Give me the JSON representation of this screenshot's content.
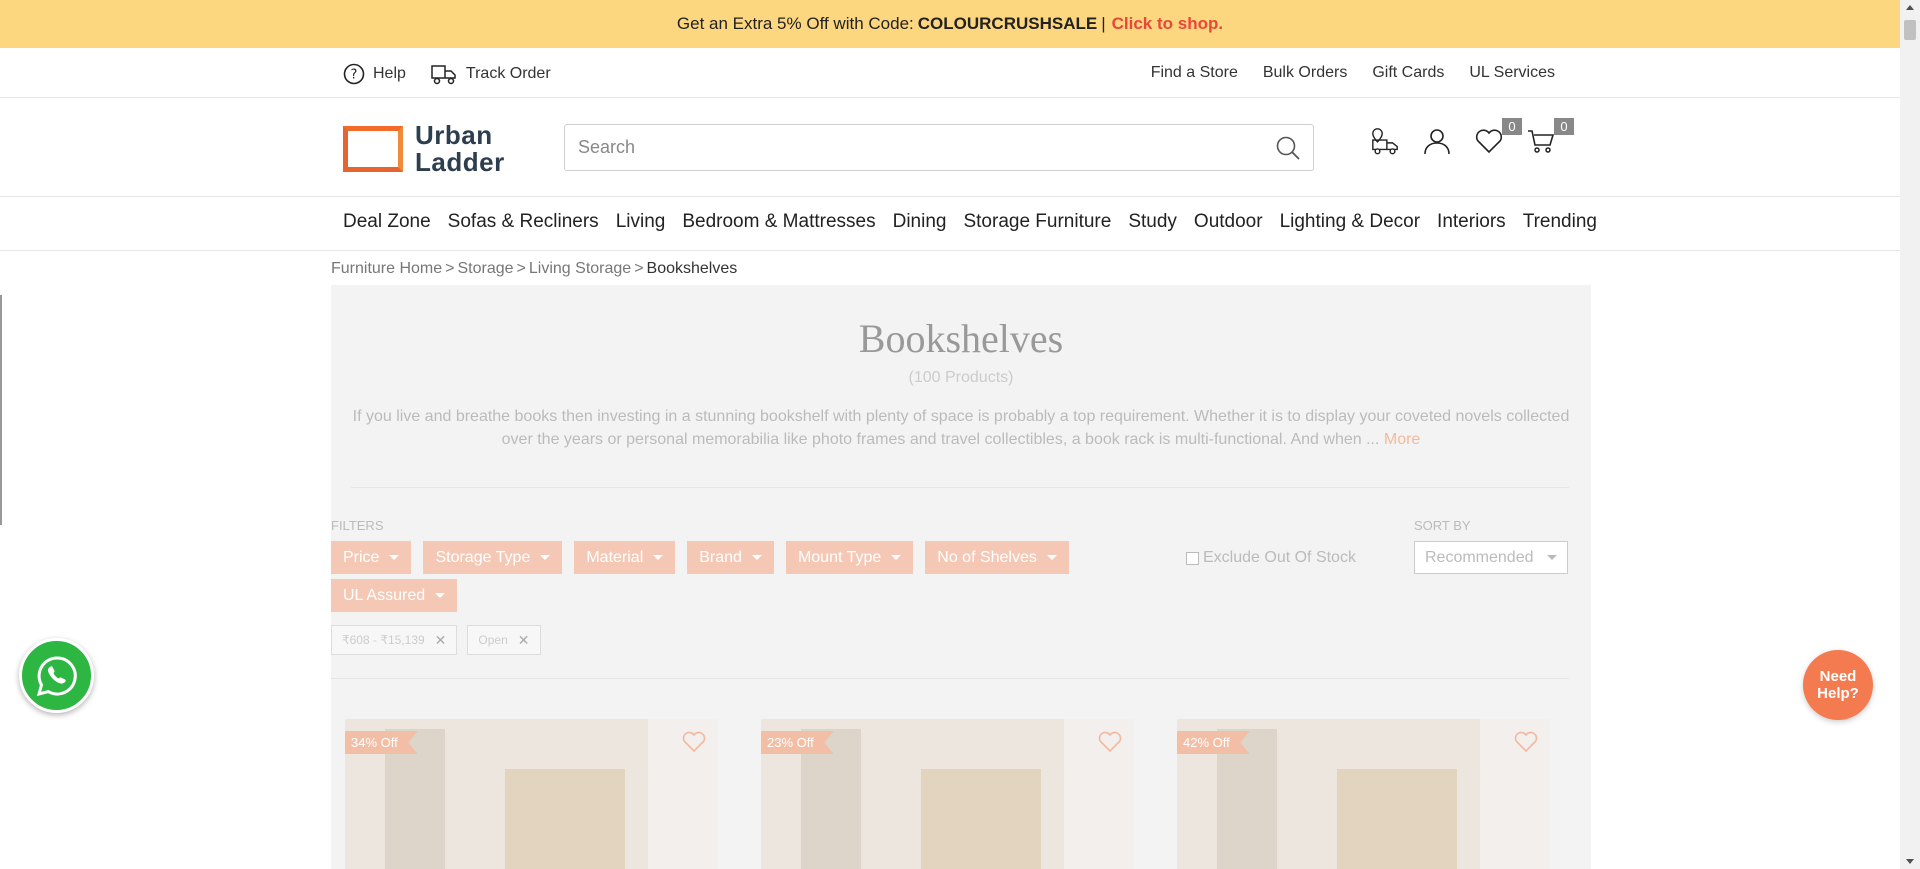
{
  "promo": {
    "text": "Get an Extra 5% Off with Code:",
    "code": "COLOURCRUSHSALE",
    "separator": "|",
    "cta": "Click to shop."
  },
  "utility": {
    "help": "Help",
    "track": "Track Order",
    "links": [
      "Find a Store",
      "Bulk Orders",
      "Gift Cards",
      "UL Services"
    ]
  },
  "logo": {
    "line1": "Urban",
    "line2": "Ladder"
  },
  "search": {
    "placeholder": "Search"
  },
  "header": {
    "wishlist_count": "0",
    "cart_count": "0"
  },
  "nav": [
    "Deal Zone",
    "Sofas & Recliners",
    "Living",
    "Bedroom & Mattresses",
    "Dining",
    "Storage Furniture",
    "Study",
    "Outdoor",
    "Lighting & Decor",
    "Interiors",
    "Trending"
  ],
  "breadcrumb": {
    "items": [
      "Furniture Home",
      "Storage",
      "Living Storage"
    ],
    "current": "Bookshelves",
    "sep": ">"
  },
  "category": {
    "title": "Bookshelves",
    "count": "(100 Products)",
    "description": "If you live and breathe books then investing in a stunning bookshelf with plenty of space is probably a top requirement. Whether it is to display your coveted novels collected over the years or personal memorabilia like photo frames and travel collectibles, a book rack is multi-functional. And when ...",
    "more": "More"
  },
  "filters": {
    "label": "FILTERS",
    "chips": [
      "Price",
      "Storage Type",
      "Material",
      "Brand",
      "Mount Type",
      "No of Shelves",
      "UL Assured"
    ],
    "exclude_label": "Exclude Out Of Stock",
    "applied": [
      "₹608 - ₹15,139",
      "Open"
    ]
  },
  "sort": {
    "label": "SORT BY",
    "value": "Recommended"
  },
  "products": [
    {
      "discount": "34% Off"
    },
    {
      "discount": "23% Off"
    },
    {
      "discount": "42% Off"
    }
  ],
  "needhelp": {
    "line1": "Need",
    "line2": "Help?"
  }
}
